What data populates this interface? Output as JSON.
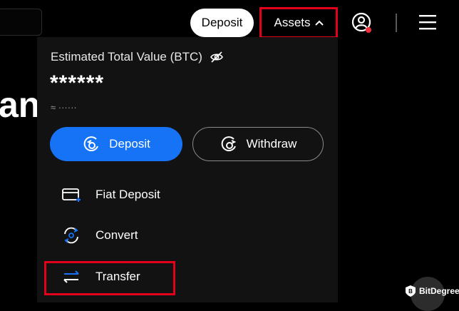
{
  "header": {
    "deposit_label": "Deposit",
    "assets_label": "Assets"
  },
  "hero": {
    "partial_text": "an"
  },
  "assets_panel": {
    "estimated_label": "Estimated Total Value (BTC)",
    "masked_value": "******",
    "approx_value": "≈ ······",
    "deposit_button": "Deposit",
    "withdraw_button": "Withdraw",
    "menu_items": [
      {
        "label": "Fiat Deposit",
        "icon": "card-plus-icon"
      },
      {
        "label": "Convert",
        "icon": "convert-icon"
      },
      {
        "label": "Transfer",
        "icon": "transfer-icon"
      }
    ]
  },
  "watermark": {
    "text": "BitDegree"
  },
  "colors": {
    "accent_blue": "#1673f5",
    "highlight_red": "#e3001b",
    "panel_bg": "#121212"
  }
}
